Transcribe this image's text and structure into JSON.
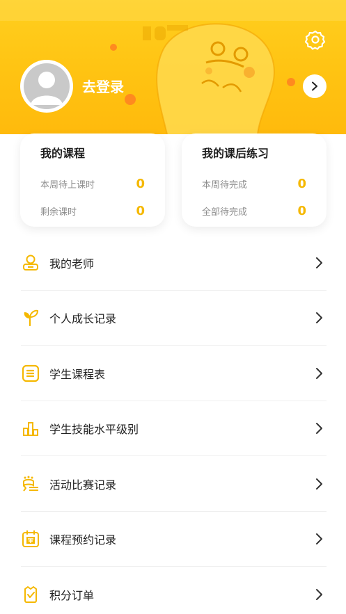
{
  "header": {
    "login_label": "去登录",
    "accent_color": "#ffc312"
  },
  "cards": [
    {
      "title": "我的课程",
      "rows": [
        {
          "label": "本周待上课时",
          "value": "0"
        },
        {
          "label": "剩余课时",
          "value": "0"
        }
      ]
    },
    {
      "title": "我的课后练习",
      "rows": [
        {
          "label": "本周待完成",
          "value": "0"
        },
        {
          "label": "全部待完成",
          "value": "0"
        }
      ]
    }
  ],
  "menu": [
    {
      "label": "我的老师",
      "icon": "teacher-icon"
    },
    {
      "label": "个人成长记录",
      "icon": "sprout-icon"
    },
    {
      "label": "学生课程表",
      "icon": "schedule-icon"
    },
    {
      "label": "学生技能水平级别",
      "icon": "level-chart-icon"
    },
    {
      "label": "活动比赛记录",
      "icon": "competition-icon"
    },
    {
      "label": "课程预约记录",
      "icon": "booking-calendar-icon"
    },
    {
      "label": "积分订单",
      "icon": "points-order-icon"
    }
  ],
  "colors": {
    "value": "#f5b800",
    "icon": "#f5b800",
    "header": "#ffc312"
  }
}
